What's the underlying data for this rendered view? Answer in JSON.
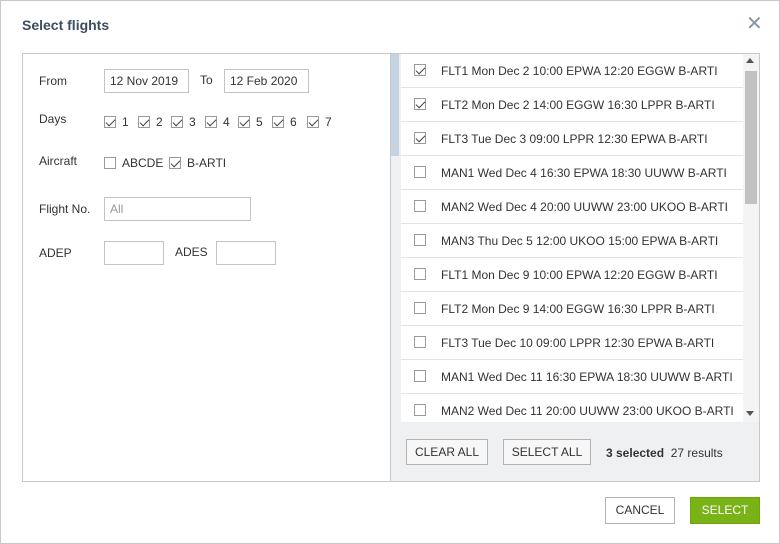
{
  "dialog": {
    "title": "Select flights"
  },
  "filters": {
    "from_label": "From",
    "from_value": "12 Nov 2019",
    "to_label": "To",
    "to_value": "12 Feb 2020",
    "days_label": "Days",
    "days": [
      {
        "label": "1",
        "checked": true
      },
      {
        "label": "2",
        "checked": true
      },
      {
        "label": "3",
        "checked": true
      },
      {
        "label": "4",
        "checked": true
      },
      {
        "label": "5",
        "checked": true
      },
      {
        "label": "6",
        "checked": true
      },
      {
        "label": "7",
        "checked": true
      }
    ],
    "aircraft_label": "Aircraft",
    "aircraft": [
      {
        "label": "ABCDE",
        "checked": false
      },
      {
        "label": "B-ARTI",
        "checked": true
      }
    ],
    "flight_no_label": "Flight No.",
    "flight_no_placeholder": "All",
    "adep_label": "ADEP",
    "ades_label": "ADES"
  },
  "flights": [
    {
      "text": "FLT1 Mon Dec 2 10:00 EPWA 12:20 EGGW B-ARTI",
      "checked": true
    },
    {
      "text": "FLT2 Mon Dec 2 14:00 EGGW 16:30 LPPR B-ARTI",
      "checked": true
    },
    {
      "text": "FLT3 Tue Dec 3 09:00 LPPR 12:30 EPWA B-ARTI",
      "checked": true
    },
    {
      "text": "MAN1 Wed Dec 4 16:30 EPWA 18:30 UUWW B-ARTI",
      "checked": false
    },
    {
      "text": "MAN2 Wed Dec 4 20:00 UUWW 23:00 UKOO B-ARTI",
      "checked": false
    },
    {
      "text": "MAN3 Thu Dec 5 12:00 UKOO 15:00 EPWA B-ARTI",
      "checked": false
    },
    {
      "text": "FLT1 Mon Dec 9 10:00 EPWA 12:20 EGGW B-ARTI",
      "checked": false
    },
    {
      "text": "FLT2 Mon Dec 9 14:00 EGGW 16:30 LPPR B-ARTI",
      "checked": false
    },
    {
      "text": "FLT3 Tue Dec 10 09:00 LPPR 12:30 EPWA B-ARTI",
      "checked": false
    },
    {
      "text": "MAN1 Wed Dec 11 16:30 EPWA 18:30 UUWW B-ARTI",
      "checked": false
    },
    {
      "text": "MAN2 Wed Dec 11 20:00 UUWW 23:00 UKOO B-ARTI",
      "checked": false
    }
  ],
  "list_actions": {
    "clear_all": "CLEAR ALL",
    "select_all": "SELECT ALL",
    "selected_count": "3 selected",
    "results_count": "27 results"
  },
  "footer": {
    "cancel": "CANCEL",
    "select": "SELECT"
  },
  "colors": {
    "select_button": "#7ab317",
    "title": "#3d4c5e",
    "selection_bar": "#c5d2e2"
  },
  "icons": {
    "close": "close-icon",
    "scroll_up": "scroll-up-arrow-icon",
    "scroll_down": "scroll-down-arrow-icon"
  }
}
